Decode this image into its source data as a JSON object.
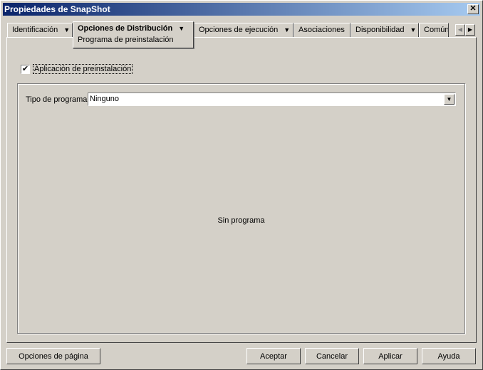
{
  "window": {
    "title": "Propiedades de SnapShot",
    "close": "✕"
  },
  "tabs": [
    {
      "label": "Identificación",
      "dropdown": true
    },
    {
      "label": "Opciones de Distribución",
      "dropdown": true,
      "active": true,
      "subpage": "Programa de preinstalación"
    },
    {
      "label": "Opciones de ejecución",
      "dropdown": true
    },
    {
      "label": "Asociaciones"
    },
    {
      "label": "Disponibilidad",
      "dropdown": true
    },
    {
      "label": "Común"
    }
  ],
  "content": {
    "checkbox_label": "Aplicación de preinstalación",
    "checkbox_checked": true,
    "program_type_label": "Tipo de programa:",
    "program_type_value": "Ninguno",
    "empty_text": "Sin programa"
  },
  "buttons": {
    "page_options": "Opciones de página",
    "ok": "Aceptar",
    "cancel": "Cancelar",
    "apply": "Aplicar",
    "help": "Ayuda"
  }
}
